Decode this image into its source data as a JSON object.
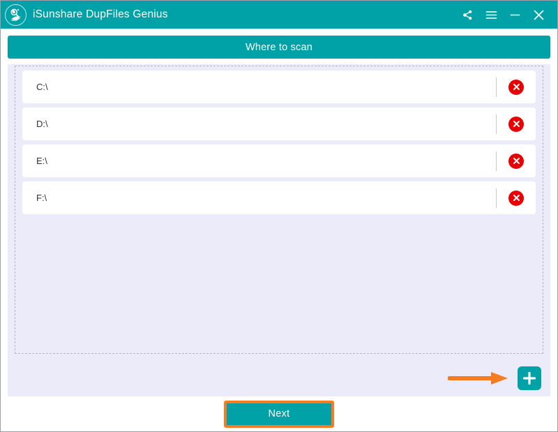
{
  "window": {
    "app_title": "iSunshare DupFiles Genius",
    "logo_icon": "magnifier-documents-logo",
    "controls": [
      {
        "name": "share-button",
        "icon": "share-icon"
      },
      {
        "name": "menu-button",
        "icon": "hamburger-menu-icon"
      },
      {
        "name": "minimize-button",
        "icon": "minimize-icon"
      },
      {
        "name": "close-button",
        "icon": "close-icon"
      }
    ]
  },
  "section": {
    "header_title": "Where to scan"
  },
  "drive_list": {
    "rows": [
      {
        "path": "C:\\",
        "remove_icon": "remove-circle-icon"
      },
      {
        "path": "D:\\",
        "remove_icon": "remove-circle-icon"
      },
      {
        "path": "E:\\",
        "remove_icon": "remove-circle-icon"
      },
      {
        "path": "F:\\",
        "remove_icon": "remove-circle-icon"
      }
    ]
  },
  "add_control": {
    "icon": "plus-icon",
    "annotation_icon": "orange-arrow-right-annotation"
  },
  "footer": {
    "next_label": "Next"
  },
  "colors": {
    "brand_teal": "#00a2a8",
    "panel_lavender": "#ebebfa",
    "highlight_orange": "#f57c20",
    "remove_red": "#ea0000",
    "row_white": "#ffffff"
  }
}
